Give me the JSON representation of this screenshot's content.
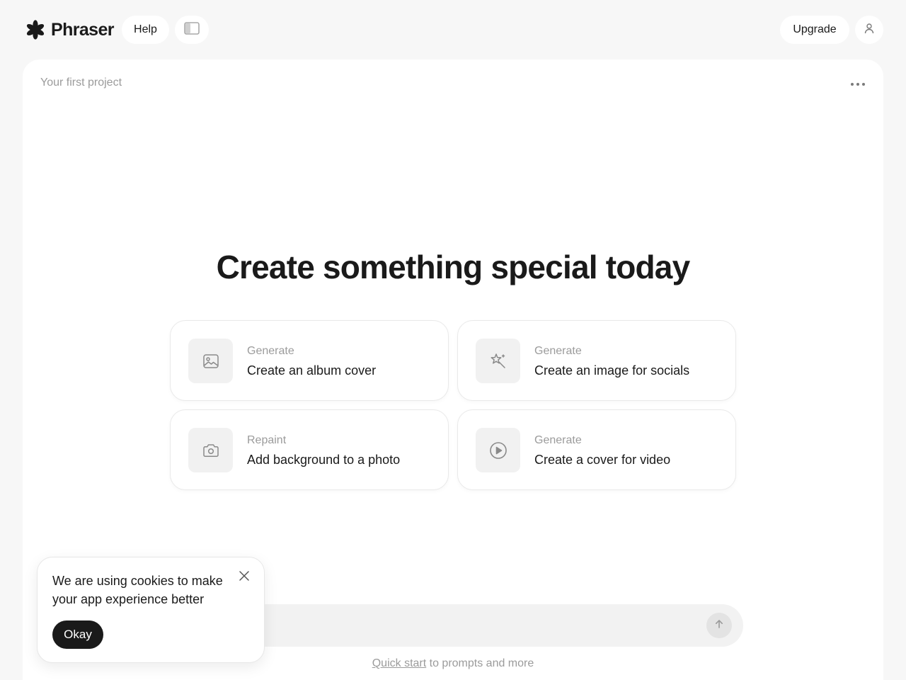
{
  "app": {
    "name": "Phraser",
    "logo_icon": "asterisk-flower-icon"
  },
  "header": {
    "help_label": "Help",
    "sidebar_toggle_icon": "sidebar-toggle-icon",
    "upgrade_label": "Upgrade",
    "profile_icon": "user-icon"
  },
  "project": {
    "title": "Your first project",
    "menu_icon": "more-dots-icon"
  },
  "hero": {
    "title": "Create something special today"
  },
  "cards": [
    {
      "kicker": "Generate",
      "title": "Create an album cover",
      "icon": "image-icon"
    },
    {
      "kicker": "Generate",
      "title": "Create an image for socials",
      "icon": "magic-wand-icon"
    },
    {
      "kicker": "Repaint",
      "title": "Add background to a photo",
      "icon": "camera-icon"
    },
    {
      "kicker": "Generate",
      "title": "Create a cover for video",
      "icon": "play-circle-icon"
    }
  ],
  "prompt": {
    "value": "",
    "placeholder": "",
    "send_icon": "arrow-up-icon"
  },
  "quickstart": {
    "link_label": "Quick start",
    "suffix": " to prompts and more"
  },
  "cookie": {
    "message": "We are using cookies to make your app experience better",
    "ok_label": "Okay",
    "close_icon": "close-icon"
  },
  "colors": {
    "background": "#f7f7f7",
    "panel": "#ffffff",
    "text": "#1a1a1a",
    "muted": "#9b9b9b",
    "tile": "#f1f1f1"
  }
}
